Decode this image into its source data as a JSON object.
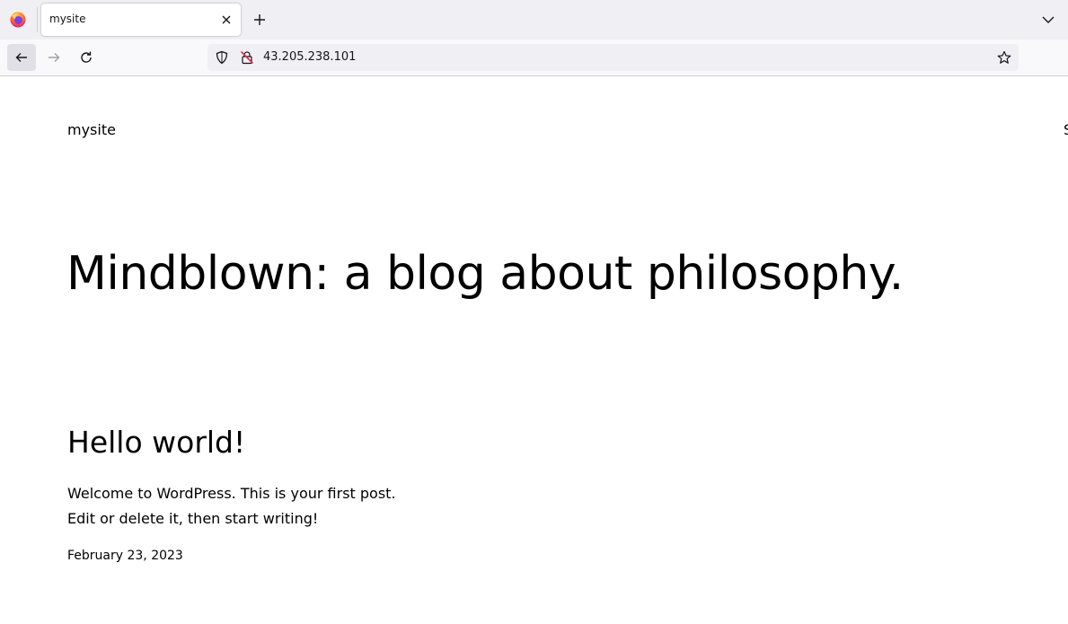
{
  "browser": {
    "tab": {
      "title": "mysite"
    },
    "url": "43.205.238.101"
  },
  "icons": {
    "firefox": "firefox-logo-icon",
    "tab_close": "close-icon",
    "new_tab": "plus-icon",
    "list_tabs": "chevron-down-icon",
    "back": "arrow-left-icon",
    "forward": "arrow-right-icon",
    "reload": "reload-icon",
    "tracking_protection": "shield-icon",
    "connection": "insecure-lock-icon",
    "bookmark": "star-icon"
  },
  "colors": {
    "tabstrip_bg": "#f0f0f4",
    "navbar_bg": "#f9f9fb",
    "insecure_lock": "#e22850",
    "page_bg": "#ffffff",
    "text": "#000000"
  },
  "page": {
    "site_title": "mysite",
    "nav_edge_text": "S",
    "headline": "Mindblown: a blog about philosophy.",
    "post": {
      "title": "Hello world!",
      "excerpt": "Welcome to WordPress. This is your first post. Edit or delete it, then start writing!",
      "date": "February 23, 2023"
    }
  }
}
